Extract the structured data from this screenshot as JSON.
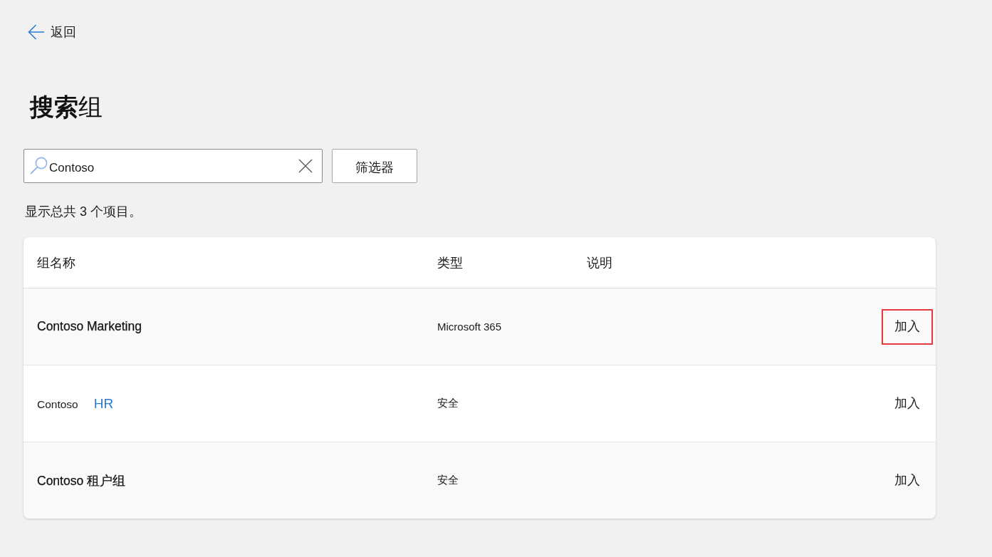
{
  "back": {
    "label": "返回"
  },
  "title": "**搜索**组",
  "search": {
    "value": "Contoso",
    "filter_button": "筛选器"
  },
  "result_count": "显示总共 3 个项目。",
  "table": {
    "columns": [
      "组名称",
      "类型",
      "说明"
    ],
    "rows": [
      {
        "name": [
          {
            "text": "Contoso Marketing",
            "kind": "strong"
          }
        ],
        "type": "Microsoft 365",
        "action": "加入",
        "highlighted": true
      },
      {
        "name": [
          {
            "text": "Contoso",
            "kind": "plain"
          },
          {
            "text": "HR",
            "kind": "link"
          }
        ],
        "type": "安全",
        "action": "加入",
        "highlighted": false
      },
      {
        "name": [
          {
            "text": "Contoso 租户组",
            "kind": "strong"
          }
        ],
        "type": "安全",
        "action": "加入",
        "highlighted": false
      }
    ]
  }
}
